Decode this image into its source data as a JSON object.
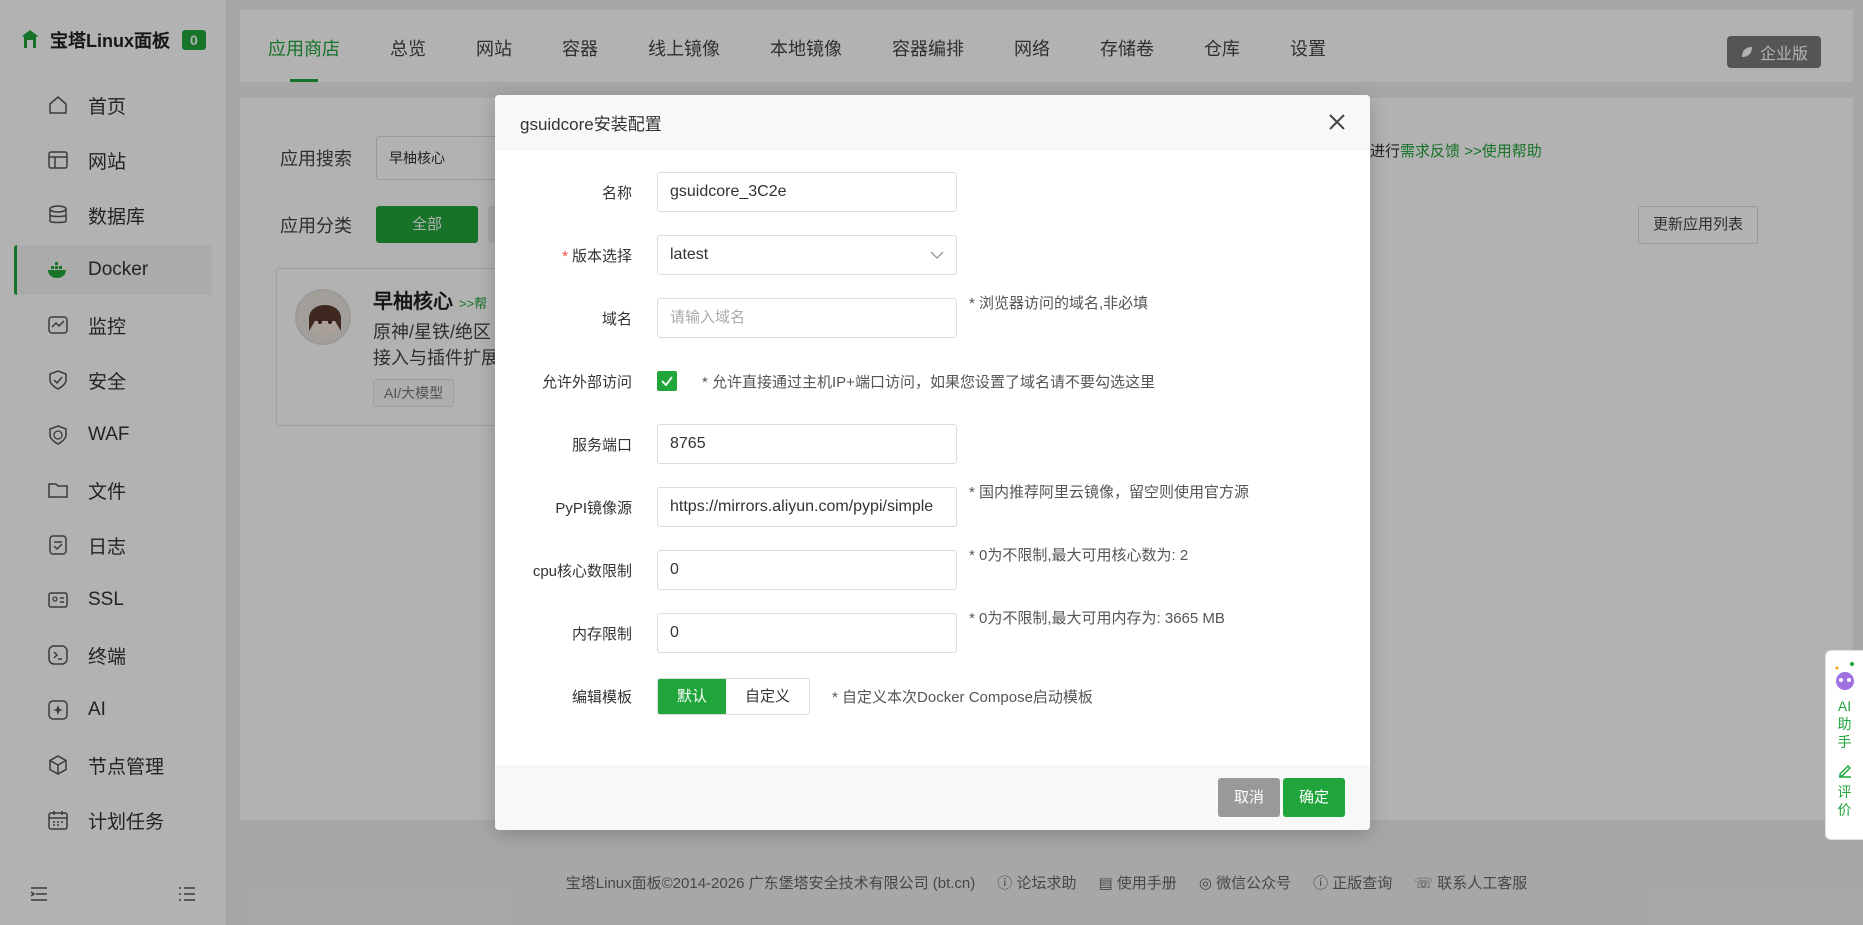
{
  "app": {
    "logo_text": "宝塔Linux面板",
    "badge_count": "0",
    "brand_color": "#20a53a"
  },
  "sidebar": {
    "items": [
      {
        "label": "首页",
        "icon": "home-icon"
      },
      {
        "label": "网站",
        "icon": "website-icon"
      },
      {
        "label": "数据库",
        "icon": "database-icon"
      },
      {
        "label": "Docker",
        "icon": "docker-icon",
        "active": true
      },
      {
        "label": "监控",
        "icon": "monitor-icon"
      },
      {
        "label": "安全",
        "icon": "shield-icon"
      },
      {
        "label": "WAF",
        "icon": "waf-icon"
      },
      {
        "label": "文件",
        "icon": "folder-icon"
      },
      {
        "label": "日志",
        "icon": "log-icon"
      },
      {
        "label": "SSL",
        "icon": "ssl-icon"
      },
      {
        "label": "终端",
        "icon": "terminal-icon"
      },
      {
        "label": "AI",
        "icon": "ai-icon"
      },
      {
        "label": "节点管理",
        "icon": "node-icon"
      },
      {
        "label": "计划任务",
        "icon": "calendar-icon"
      }
    ]
  },
  "topnav": {
    "tabs": [
      {
        "label": "应用商店",
        "active": true
      },
      {
        "label": "总览"
      },
      {
        "label": "网站"
      },
      {
        "label": "容器"
      },
      {
        "label": "线上镜像"
      },
      {
        "label": "本地镜像"
      },
      {
        "label": "容器编排"
      },
      {
        "label": "网络"
      },
      {
        "label": "存储卷"
      },
      {
        "label": "仓库"
      },
      {
        "label": "设置"
      }
    ],
    "enterprise_label": "企业版"
  },
  "main": {
    "search_label": "应用搜索",
    "search_value": "早柚核心",
    "help_prefix": "进行",
    "help_feedback": "需求反馈",
    "help_sep": " >>",
    "help_usage": "使用帮助",
    "category_label": "应用分类",
    "category_all": "全部",
    "update_list_label": "更新应用列表",
    "card": {
      "title": "早柚核心",
      "help": ">>帮",
      "desc_line1": "原神/星铁/绝区",
      "desc_line2": "接入与插件扩展",
      "tag": "AI/大模型"
    }
  },
  "footer": {
    "copyright": "宝塔Linux面板©2014-2026 广东堡塔安全技术有限公司 (bt.cn)",
    "links": [
      "论坛求助",
      "使用手册",
      "微信公众号",
      "正版查询",
      "联系人工客服"
    ]
  },
  "ai_widget": {
    "label1": "AI",
    "label2": "助",
    "label3": "手",
    "label4": "评",
    "label5": "价"
  },
  "modal": {
    "title": "gsuidcore安装配置",
    "fields": {
      "name": {
        "label": "名称",
        "value": "gsuidcore_3C2e"
      },
      "version": {
        "label": "版本选择",
        "value": "latest",
        "required": "*"
      },
      "domain": {
        "label": "域名",
        "placeholder": "请输入域名",
        "tip": "* 浏览器访问的域名,非必填"
      },
      "external": {
        "label": "允许外部访问",
        "checked": true,
        "tip": "* 允许直接通过主机IP+端口访问，如果您设置了域名请不要勾选这里"
      },
      "port": {
        "label": "服务端口",
        "value": "8765"
      },
      "pypi": {
        "label": "PyPI镜像源",
        "value": "https://mirrors.aliyun.com/pypi/simple",
        "tip": "* 国内推荐阿里云镜像，留空则使用官方源"
      },
      "cpu": {
        "label": "cpu核心数限制",
        "value": "0",
        "tip": "* 0为不限制,最大可用核心数为: 2"
      },
      "memory": {
        "label": "内存限制",
        "value": "0",
        "tip": "* 0为不限制,最大可用内存为: 3665 MB"
      },
      "template": {
        "label": "编辑模板",
        "option_default": "默认",
        "option_custom": "自定义",
        "tip": "* 自定义本次Docker Compose启动模板"
      }
    },
    "cancel_label": "取消",
    "confirm_label": "确定"
  }
}
